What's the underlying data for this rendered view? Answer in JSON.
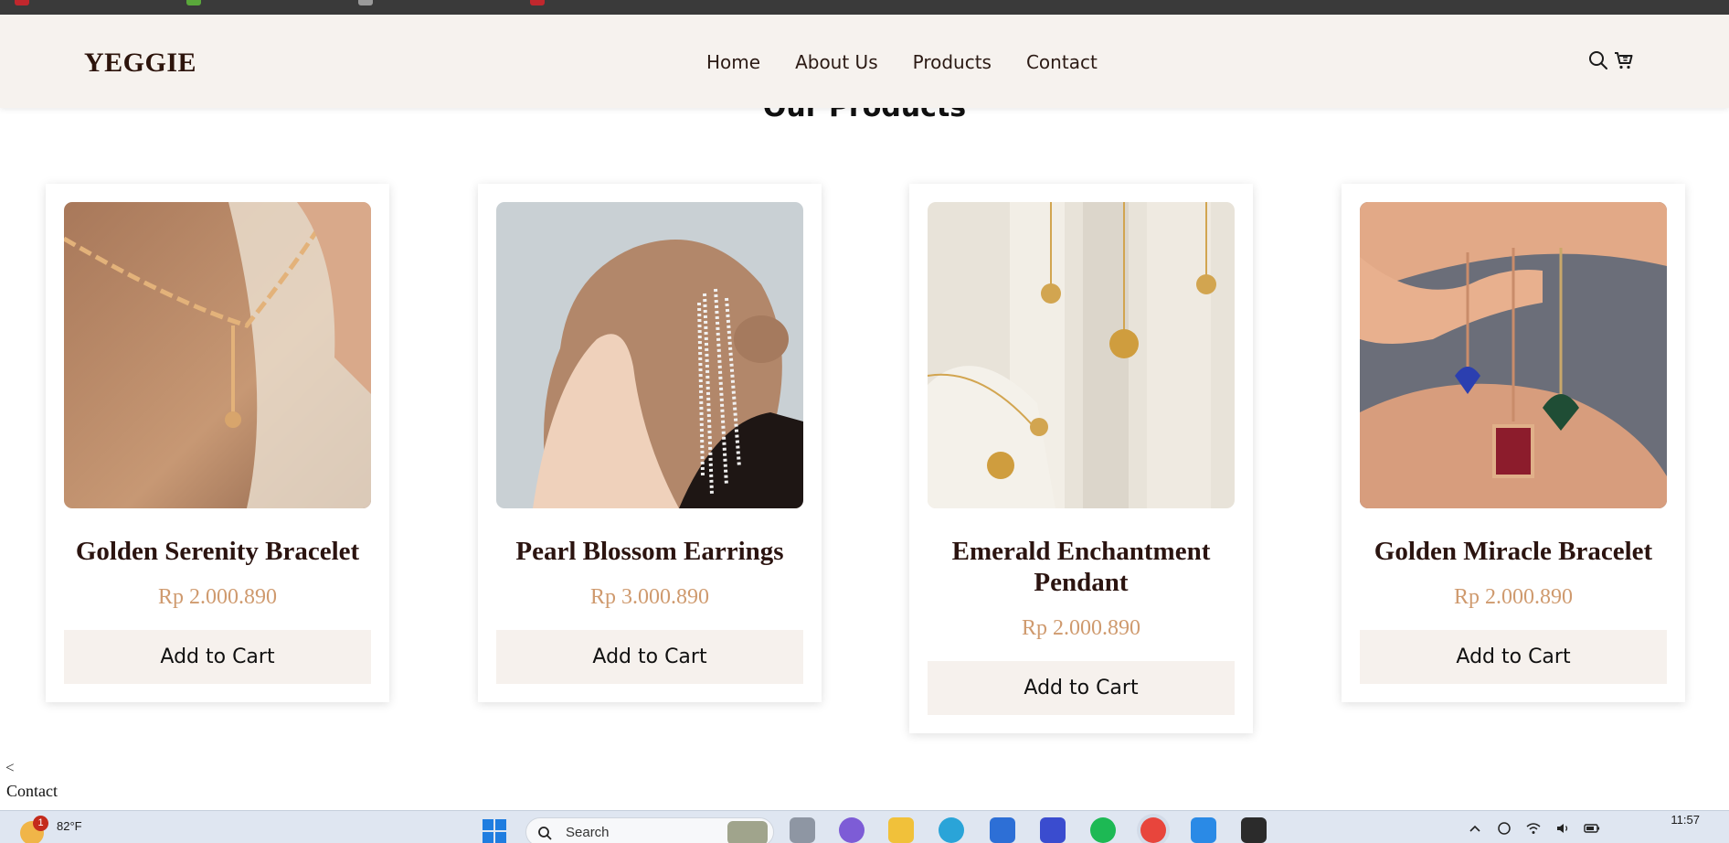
{
  "header": {
    "brand": "YEGGIE",
    "nav": [
      "Home",
      "About Us",
      "Products",
      "Contact"
    ],
    "icons": [
      "search-icon",
      "cart-icon"
    ]
  },
  "section": {
    "title": "Our Products"
  },
  "products": [
    {
      "name": "Golden Serenity Bracelet",
      "price": "Rp 2.000.890",
      "button": "Add to Cart"
    },
    {
      "name": "Pearl Blossom Earrings",
      "price": "Rp 3.000.890",
      "button": "Add to Cart"
    },
    {
      "name": "Emerald Enchantment Pendant",
      "price": "Rp 2.000.890",
      "button": "Add to Cart"
    },
    {
      "name": "Golden Miracle Bracelet",
      "price": "Rp 2.000.890",
      "button": "Add to Cart"
    }
  ],
  "footer_text": {
    "arrow": "<",
    "contact": "Contact"
  },
  "taskbar": {
    "weather_temp": "82°F",
    "weather_badge": "1",
    "search_placeholder": "Search",
    "time": "11:57"
  },
  "colors": {
    "header_bg": "#f6f2ee",
    "brand": "#2d140c",
    "price": "#cf9a6e",
    "button_bg": "#f6f1ed"
  }
}
